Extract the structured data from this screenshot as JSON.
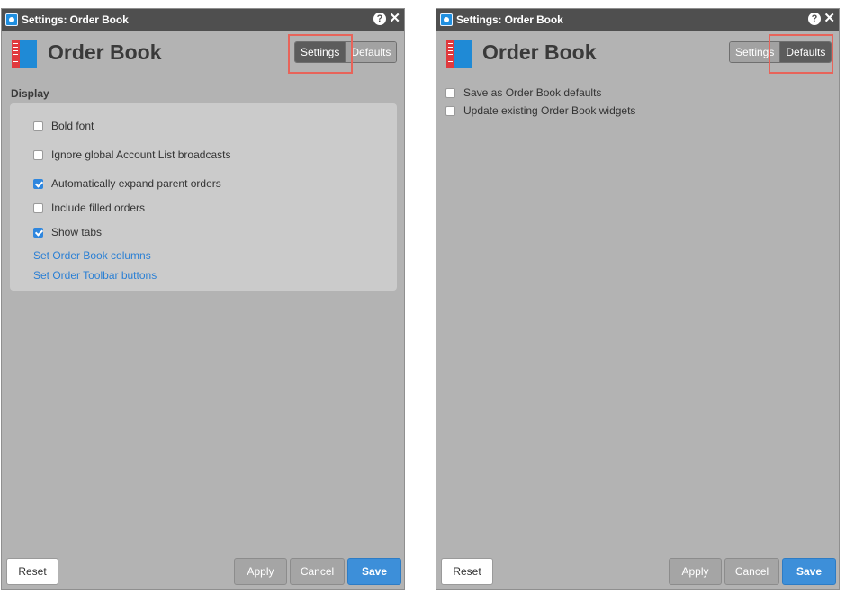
{
  "left_panel": {
    "window_title": "Settings: Order Book",
    "heading": "Order Book",
    "tabs": {
      "settings": "Settings",
      "defaults": "Defaults",
      "active": "settings"
    },
    "section_title": "Display",
    "options": [
      {
        "label": "Bold font",
        "checked": false
      },
      {
        "label": "Ignore global Account List broadcasts",
        "checked": false
      },
      {
        "label": "Automatically expand parent orders",
        "checked": true
      },
      {
        "label": "Include filled orders",
        "checked": false
      },
      {
        "label": "Show tabs",
        "checked": true
      }
    ],
    "links": [
      "Set Order Book columns",
      "Set Order Toolbar buttons"
    ],
    "buttons": {
      "reset": "Reset",
      "apply": "Apply",
      "cancel": "Cancel",
      "save": "Save"
    }
  },
  "right_panel": {
    "window_title": "Settings: Order Book",
    "heading": "Order Book",
    "tabs": {
      "settings": "Settings",
      "defaults": "Defaults",
      "active": "defaults"
    },
    "options": [
      {
        "label": "Save as Order Book defaults",
        "checked": false
      },
      {
        "label": "Update existing Order Book widgets",
        "checked": false
      }
    ],
    "buttons": {
      "reset": "Reset",
      "apply": "Apply",
      "cancel": "Cancel",
      "save": "Save"
    }
  },
  "icons": {
    "help": "?",
    "close": "✕",
    "app": "gear-flower-icon",
    "book": "order-book-icon"
  },
  "colors": {
    "accent": "#3d8fd9",
    "link": "#2a7fd4",
    "highlight": "#e8645a",
    "titlebar": "#4f4f4f",
    "panel_bg": "#b3b3b3"
  }
}
